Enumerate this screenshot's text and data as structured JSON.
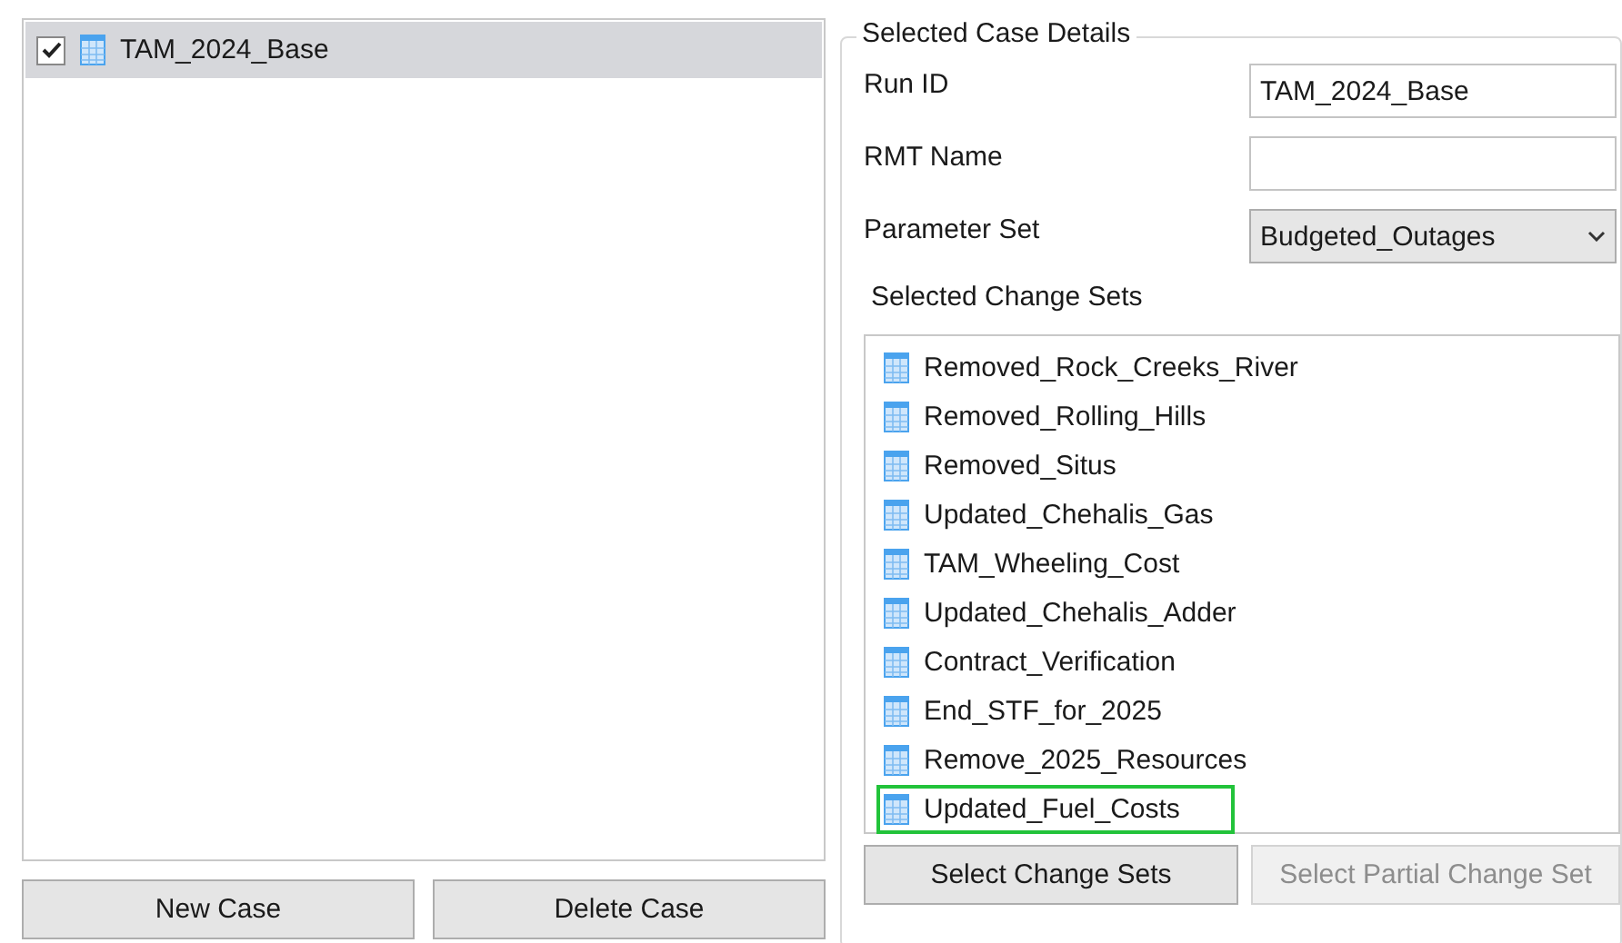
{
  "cases": [
    {
      "name": "TAM_2024_Base",
      "checked": true,
      "selected": true
    }
  ],
  "case_buttons": [
    {
      "label": "New Case",
      "disabled": false
    },
    {
      "label": "Delete Case",
      "disabled": false
    }
  ],
  "details": {
    "title": "Selected Case Details",
    "fields": [
      {
        "label": "Run ID",
        "kind": "text",
        "value": "TAM_2024_Base"
      },
      {
        "label": "RMT Name",
        "kind": "text"
      },
      {
        "label": "Parameter Set",
        "kind": "dropdown",
        "value": "Budgeted_Outages"
      }
    ],
    "change_sets_label": "Selected Change Sets",
    "change_sets": [
      {
        "name": "Removed_Rock_Creeks_River",
        "highlighted": false
      },
      {
        "name": "Removed_Rolling_Hills",
        "highlighted": false
      },
      {
        "name": "Removed_Situs",
        "highlighted": false
      },
      {
        "name": "Updated_Chehalis_Gas",
        "highlighted": false
      },
      {
        "name": "TAM_Wheeling_Cost",
        "highlighted": false
      },
      {
        "name": "Updated_Chehalis_Adder",
        "highlighted": false
      },
      {
        "name": "Contract_Verification",
        "highlighted": false
      },
      {
        "name": "End_STF_for_2025",
        "highlighted": false
      },
      {
        "name": "Remove_2025_Resources",
        "highlighted": false
      },
      {
        "name": "Updated_Fuel_Costs",
        "highlighted": true
      }
    ],
    "buttons": [
      {
        "label": "Select Change Sets",
        "disabled": false
      },
      {
        "label": "Select Partial Change Set",
        "disabled": true
      }
    ]
  }
}
